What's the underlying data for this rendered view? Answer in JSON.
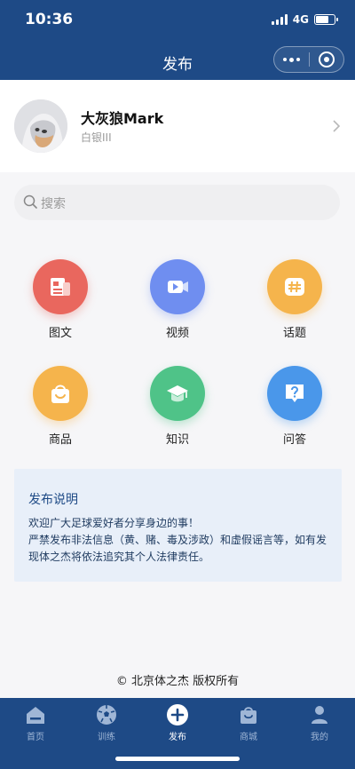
{
  "status": {
    "time": "10:36",
    "network": "4G"
  },
  "nav": {
    "title": "发布"
  },
  "profile": {
    "name": "大灰狼Mark",
    "level": "白银III"
  },
  "search": {
    "placeholder": "搜索"
  },
  "grid": [
    {
      "label": "图文",
      "icon": "news-icon",
      "color": "#e9675e"
    },
    {
      "label": "视频",
      "icon": "video-icon",
      "color": "#6f8ef0"
    },
    {
      "label": "话题",
      "icon": "topic-hash-icon",
      "color": "#f5b44c"
    },
    {
      "label": "商品",
      "icon": "shopping-bag-icon",
      "color": "#f5b44c"
    },
    {
      "label": "知识",
      "icon": "graduation-cap-icon",
      "color": "#4fc388"
    },
    {
      "label": "问答",
      "icon": "question-bubble-icon",
      "color": "#4a97ea"
    }
  ],
  "notice": {
    "title": "发布说明",
    "lines": [
      "欢迎广大足球爱好者分享身边的事！",
      "严禁发布非法信息（黄、赌、毒及涉政）和虚假谣言等，如有发现体之杰将依法追究其个人法律责任。"
    ]
  },
  "footer": {
    "copyright": "© 北京体之杰 版权所有"
  },
  "tabbar": [
    {
      "label": "首页",
      "icon": "home-icon",
      "active": false
    },
    {
      "label": "训练",
      "icon": "football-icon",
      "active": false
    },
    {
      "label": "发布",
      "icon": "plus-circle-icon",
      "active": true
    },
    {
      "label": "商城",
      "icon": "shop-bag-icon",
      "active": false
    },
    {
      "label": "我的",
      "icon": "user-icon",
      "active": false
    }
  ],
  "colors": {
    "brand": "#1e4a86",
    "notice_bg": "#e8eff9"
  }
}
